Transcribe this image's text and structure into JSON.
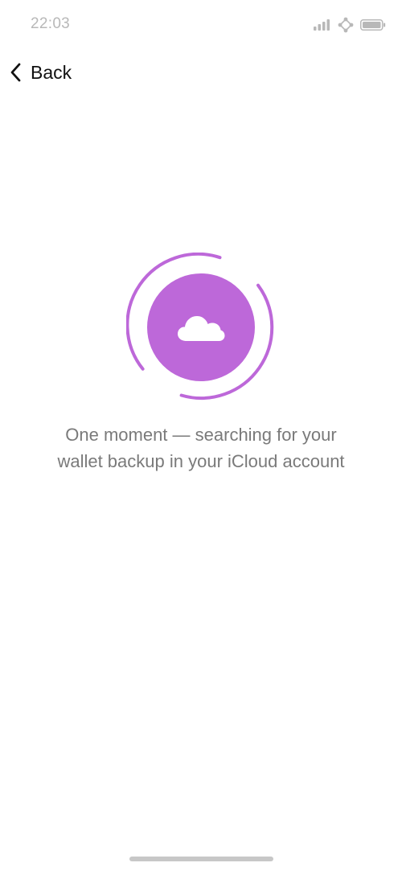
{
  "status_bar": {
    "time": "22:03",
    "icons": [
      "signal-icon",
      "wifi-icon",
      "battery-icon"
    ]
  },
  "nav": {
    "back_label": "Back",
    "back_icon": "chevron-left-icon"
  },
  "loader": {
    "icon": "cloud-icon",
    "accent_color": "#bd68d9"
  },
  "message": {
    "line1": "One moment — searching for your",
    "line2": "wallet backup in your iCloud account"
  }
}
